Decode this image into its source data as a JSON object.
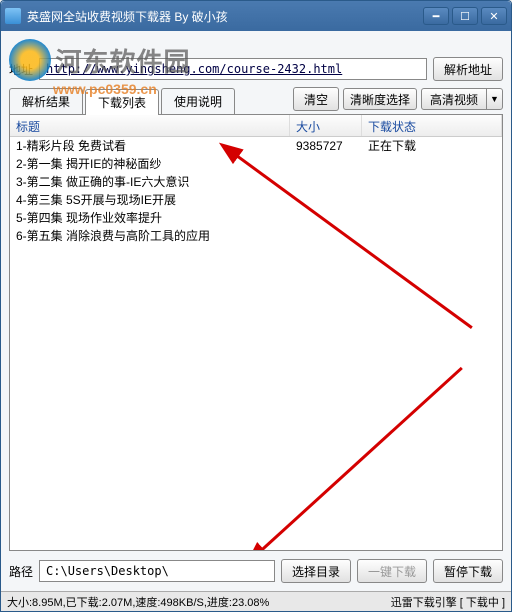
{
  "watermark": {
    "brand": "河东软件园",
    "sub": "www.pc0359.cn"
  },
  "titlebar": {
    "title": "英盛网全站收费视频下载器 By 破小孩"
  },
  "url": {
    "label": "地址",
    "value": "http://www.yingsheng.com/course-2432.html",
    "parse_btn": "解析地址"
  },
  "tabs": {
    "list": [
      {
        "label": "解析结果"
      },
      {
        "label": "下载列表"
      },
      {
        "label": "使用说明"
      }
    ],
    "active_index": 1,
    "clear_btn": "清空",
    "clarity_label": "清晰度选择",
    "clarity_value": "高清视频"
  },
  "table": {
    "headers": {
      "title": "标题",
      "size": "大小",
      "status": "下载状态"
    },
    "rows": [
      {
        "title": "1-精彩片段 免费试看",
        "size": "9385727",
        "status": "正在下载"
      },
      {
        "title": "2-第一集 揭开IE的神秘面纱",
        "size": "",
        "status": ""
      },
      {
        "title": "3-第二集 做正确的事-IE六大意识",
        "size": "",
        "status": ""
      },
      {
        "title": "4-第三集 5S开展与现场IE开展",
        "size": "",
        "status": ""
      },
      {
        "title": "5-第四集 现场作业效率提升",
        "size": "",
        "status": ""
      },
      {
        "title": "6-第五集 消除浪费与高阶工具的应用",
        "size": "",
        "status": ""
      }
    ]
  },
  "path": {
    "label": "路径",
    "value": "C:\\Users\\Desktop\\",
    "choose_btn": "选择目录",
    "onekey_btn": "一键下载",
    "pause_btn": "暂停下载"
  },
  "status": {
    "left": "大小:8.95M,已下载:2.07M,速度:498KB/S,进度:23.08%",
    "right": "迅雷下载引擎 [ 下载中 ]"
  }
}
